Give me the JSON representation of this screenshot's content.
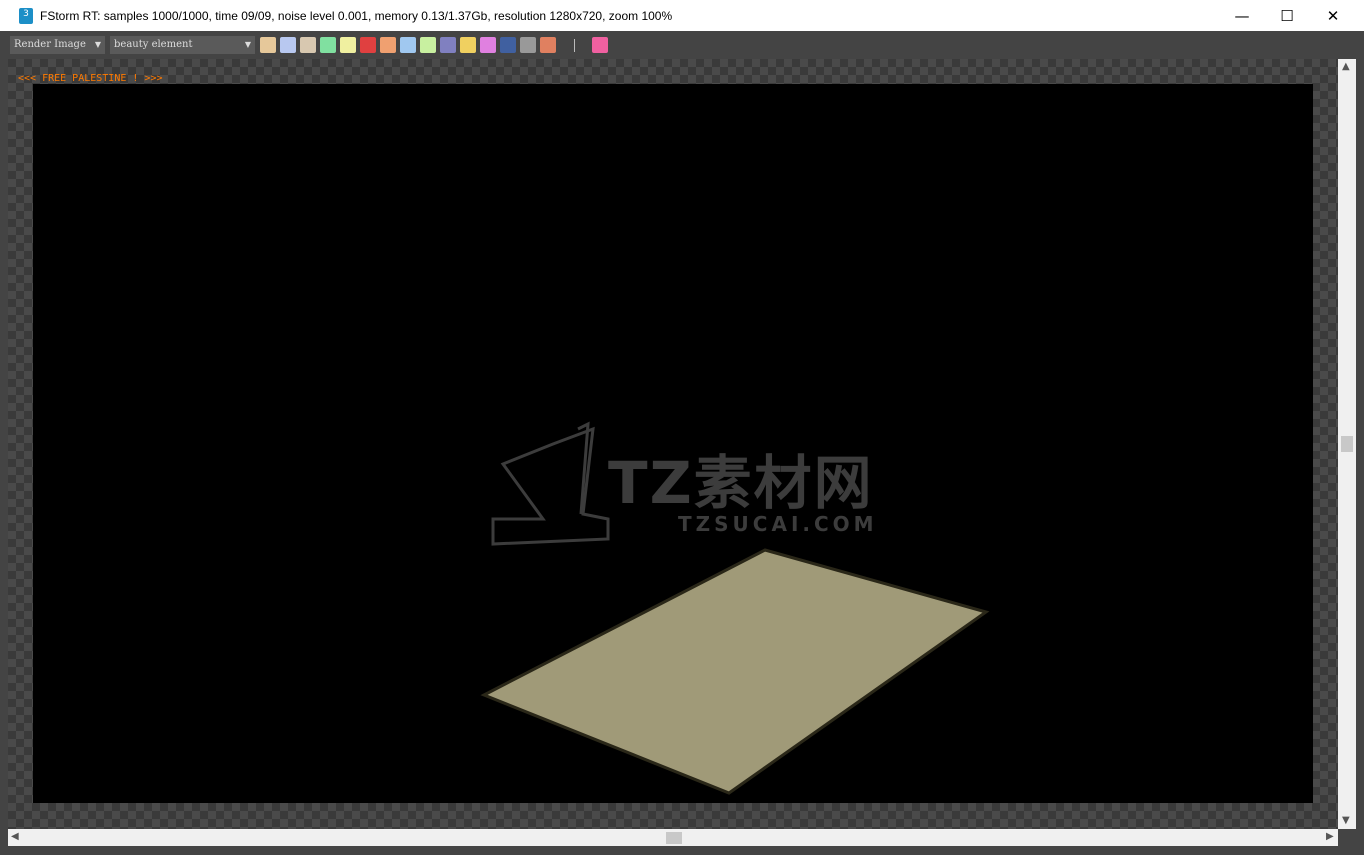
{
  "window": {
    "title": "FStorm RT: samples 1000/1000,  time 09/09,  noise level 0.001,  memory 0.13/1.37Gb,  resolution 1280x720,  zoom 100%",
    "app_icon_text": "3",
    "minimize": "—",
    "maximize": "☐",
    "close": "✕"
  },
  "toolbar": {
    "channel_select": "Render Image",
    "element_select": "beauty element",
    "icons": [
      "lock-icon",
      "save-icon",
      "copy-icon",
      "clone-icon",
      "clipboard-icon",
      "color-channels-icon",
      "pause-icon",
      "fit-icon",
      "frame-icon",
      "navigate-icon",
      "region-icon",
      "color-wheel-icon",
      "zoom-gb-icon",
      "alpha-icon",
      "unlock-icon",
      "refresh-icon"
    ]
  },
  "banner": "<<<  FREE PALESTINE ! >>>",
  "watermark": {
    "main": "TZ素材网",
    "sub": "TZSUCAI.COM"
  },
  "colors": {
    "paper": "#a09a78",
    "banner": "#ff7a00"
  }
}
